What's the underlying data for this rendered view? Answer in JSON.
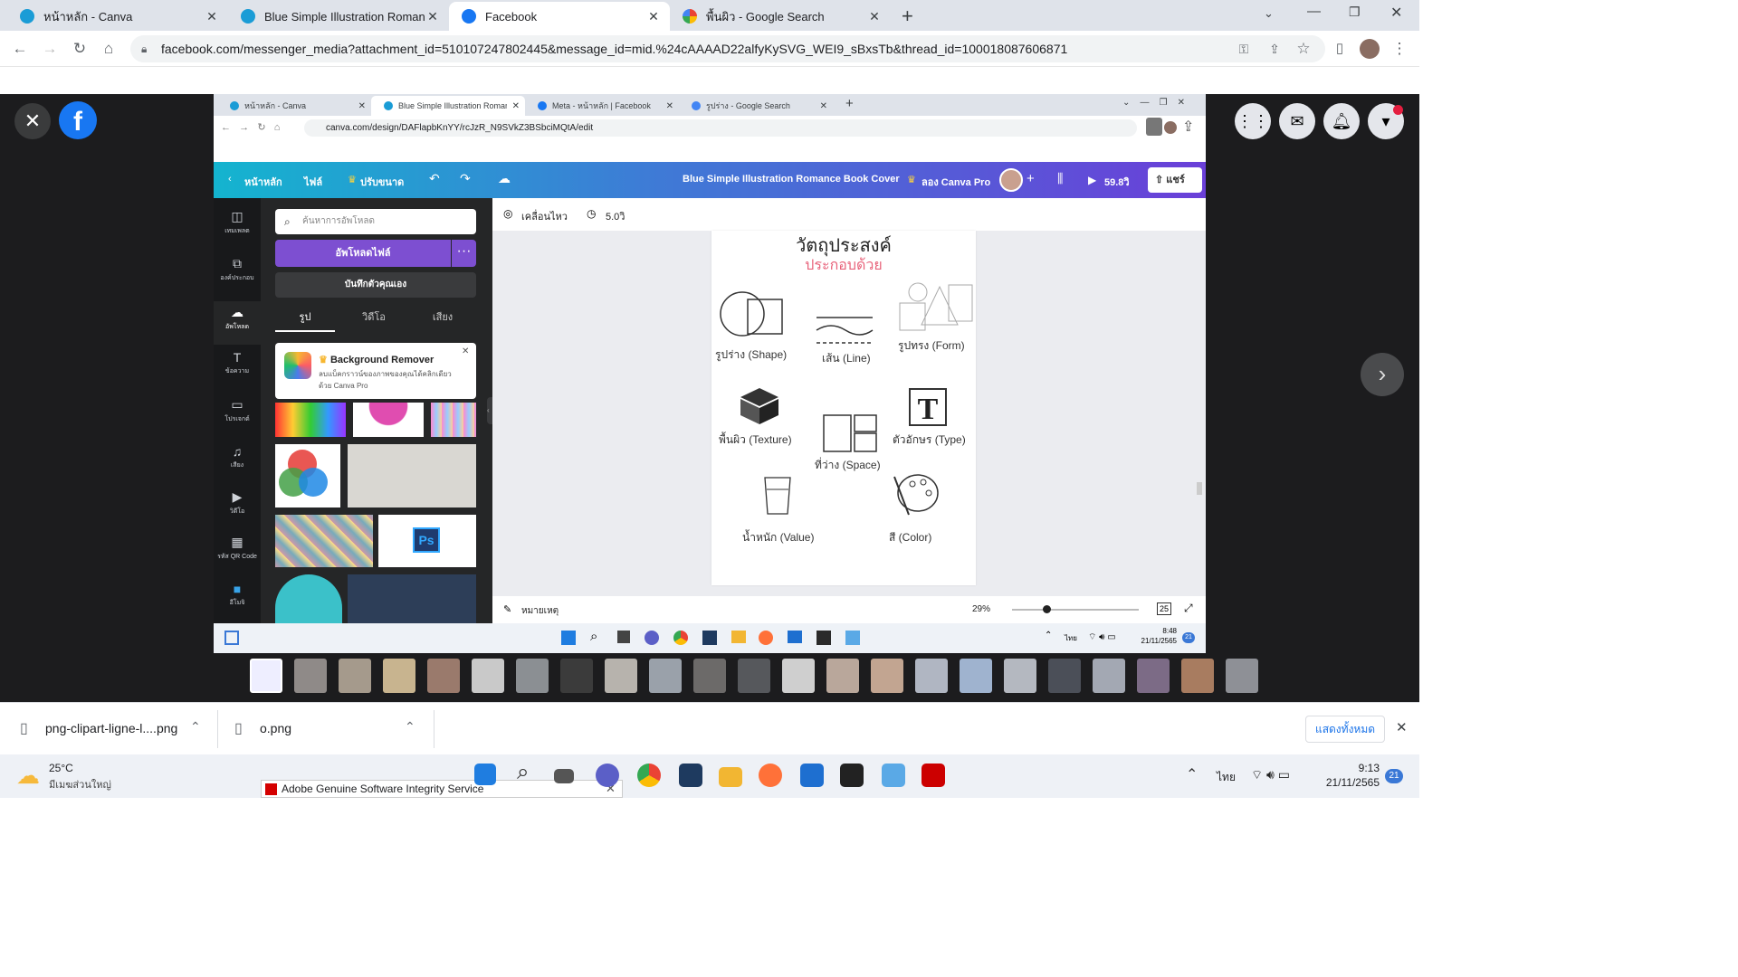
{
  "outer_tabs": [
    {
      "title": "หน้าหลัก - Canva",
      "favicon": "canva-icon",
      "color": "#1a9cd6"
    },
    {
      "title": "Blue Simple Illustration Romance",
      "favicon": "canva-icon",
      "color": "#1a9cd6"
    },
    {
      "title": "Facebook",
      "favicon": "facebook-icon",
      "color": "#1877f2"
    },
    {
      "title": "พื้นผิว - Google Search",
      "favicon": "google-icon",
      "color": "#4285f4"
    }
  ],
  "outer_url": "facebook.com/messenger_media?attachment_id=510107247802445&message_id=mid.%24cAAAAD22alfyKySVG_WEI9_sBxsTb&thread_id=100018087606871",
  "inner": {
    "tabs": [
      {
        "title": "หน้าหลัก - Canva"
      },
      {
        "title": "Blue Simple Illustration Romance"
      },
      {
        "title": "Meta - หน้าหลัก | Facebook"
      },
      {
        "title": "รูปร่าง - Google Search"
      }
    ],
    "url": "canva.com/design/DAFlapbKnYY/rcJzR_N9SVkZ3BSbciMQtA/edit",
    "topbar": {
      "home": "หน้าหลัก",
      "file": "ไฟล์",
      "resize": "ปรับขนาด",
      "design_title": "Blue Simple Illustration Romance Book Cover",
      "try_pro": "ลอง Canva Pro",
      "present_time": "59.8วิ",
      "share": "แชร์"
    },
    "rail": [
      "เทมเพลต",
      "องค์ประกอบ",
      "อัพโหลด",
      "ข้อความ",
      "โปรเจกต์",
      "เสียง",
      "วิดีโอ",
      "รหัส QR Code",
      "อีโมจิ"
    ],
    "panel": {
      "search_placeholder": "ค้นหาการอัพโหลด",
      "upload_button": "อัพโหลดไฟล์",
      "record_button": "บันทึกตัวคุณเอง",
      "tabs": [
        "รูป",
        "วิดีโอ",
        "เสียง"
      ],
      "promo_title": "Background Remover",
      "promo_text": "ลบแบ็คกราวน์ของภาพของคุณได้คลิกเดียว ด้วย Canva Pro"
    },
    "toolbar": {
      "animate": "เคลื่อนไหว",
      "duration": "5.0วิ"
    },
    "page": {
      "title": "วัตถุประสงค์",
      "subtitle": "ประกอบด้วย",
      "items": [
        "รูปร่าง (Shape)",
        "เส้น (Line)",
        "รูปทรง (Form)",
        "พื้นผิว (Texture)",
        "ที่ว่าง (Space)",
        "ตัวอักษร (Type)",
        "น้ำหนัก (Value)",
        "สี (Color)"
      ]
    },
    "footer": {
      "notes": "หมายเหตุ",
      "zoom": "29%",
      "page_count": "25"
    },
    "taskbar": {
      "lang": "ไทย",
      "time": "8:48",
      "date": "21/11/2565",
      "badge": "21"
    }
  },
  "downloads": [
    {
      "name": "png-clipart-ligne-l....png"
    },
    {
      "name": "o.png"
    }
  ],
  "downloads_show_all": "แสดงทั้งหมด",
  "notification": "Adobe Genuine Software Integrity Service",
  "weather": {
    "temp": "25°C",
    "desc": "มีเมฆส่วนใหญ่"
  },
  "clock": {
    "time": "9:13",
    "date": "21/11/2565",
    "badge": "21",
    "lang": "ไทย"
  }
}
